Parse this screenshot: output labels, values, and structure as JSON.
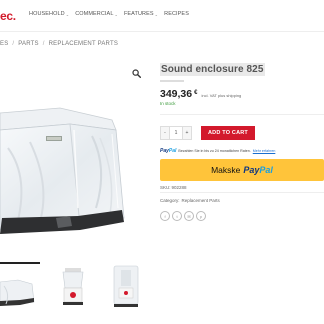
{
  "header": {
    "logo": "ec.",
    "nav": [
      {
        "label": "HOUSEHOLD",
        "has_dropdown": true
      },
      {
        "label": "COMMERCIAL",
        "has_dropdown": true
      },
      {
        "label": "FEATURES",
        "has_dropdown": true
      },
      {
        "label": "RECIPES",
        "has_dropdown": false
      }
    ]
  },
  "breadcrumb": {
    "items": [
      "ES",
      "PARTS",
      "REPLACEMENT PARTS"
    ],
    "separator": "/"
  },
  "product": {
    "title": "Sound enclosure 825",
    "price": "349,36",
    "currency": "€",
    "tax_note": "incl. VAT plus shipping",
    "stock": "In stock",
    "quantity": "1",
    "minus": "-",
    "plus": "+",
    "add_to_cart": "ADD TO CART",
    "paypal_note": {
      "brand_pay": "Pay",
      "brand_pal": "Pal",
      "text": "Bezahlen Sie in bis zu 24 monatlichen Raten.",
      "link": "Mehr erfahren"
    },
    "paypal_button": {
      "label": "Makske",
      "brand_pay": "Pay",
      "brand_pal": "Pal"
    },
    "sku_label": "SKU:",
    "sku_value": "902288",
    "category_label": "Category:",
    "category_value": "Replacement Parts",
    "share_icons": [
      "facebook-icon",
      "twitter-icon",
      "email-icon",
      "pinterest-icon"
    ]
  },
  "thumbnails": [
    "thumbnail-sound-enclosure-side",
    "thumbnail-blender-front",
    "thumbnail-blender-enclosure"
  ],
  "colors": {
    "brand_red": "#d3192c",
    "paypal_yellow": "#ffc43a",
    "paypal_navy": "#0e3680",
    "paypal_blue": "#1a9fe0",
    "stock_green": "#3a9a3a"
  }
}
